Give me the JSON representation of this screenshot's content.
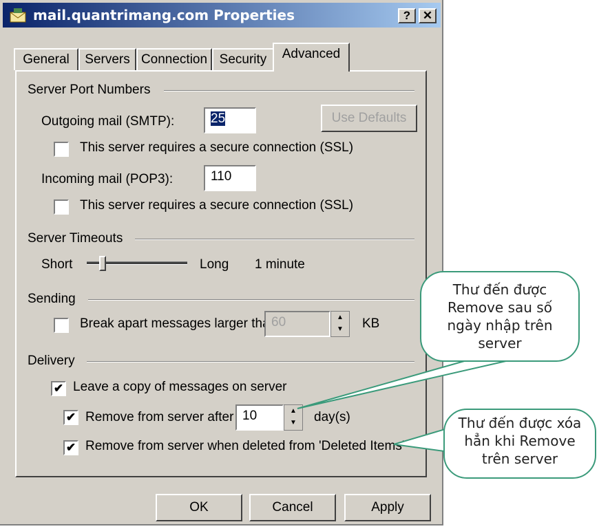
{
  "window": {
    "title": "mail.quantrimang.com Properties",
    "help_btn": "?",
    "close_btn": "✕"
  },
  "tabs": [
    {
      "label": "General"
    },
    {
      "label": "Servers"
    },
    {
      "label": "Connection"
    },
    {
      "label": "Security"
    },
    {
      "label": "Advanced"
    }
  ],
  "ports": {
    "group": "Server Port Numbers",
    "outgoing_label": "Outgoing mail (SMTP):",
    "outgoing_value": "25",
    "use_defaults": "Use Defaults",
    "ssl1": "This server requires a secure connection (SSL)",
    "incoming_label": "Incoming mail (POP3):",
    "incoming_value": "110",
    "ssl2": "This server requires a secure connection (SSL)"
  },
  "timeouts": {
    "group": "Server Timeouts",
    "short": "Short",
    "long": "Long",
    "value": "1 minute"
  },
  "sending": {
    "group": "Sending",
    "break_label": "Break apart messages larger than",
    "break_value": "60",
    "unit": "KB"
  },
  "delivery": {
    "group": "Delivery",
    "leave_copy": "Leave a copy of messages on server",
    "remove_after": "Remove from server after",
    "remove_days": "10",
    "days": "day(s)",
    "remove_deleted": "Remove from server when deleted from 'Deleted Items'"
  },
  "buttons": {
    "ok": "OK",
    "cancel": "Cancel",
    "apply": "Apply"
  },
  "callouts": {
    "c1": "Thư đến được Remove sau số ngày nhập trên server",
    "c2": "Thư đến được xóa hẳn khi Remove trên server"
  },
  "colors": {
    "titlebar": "#0a246a",
    "callout_border": "#3a9a7a"
  }
}
